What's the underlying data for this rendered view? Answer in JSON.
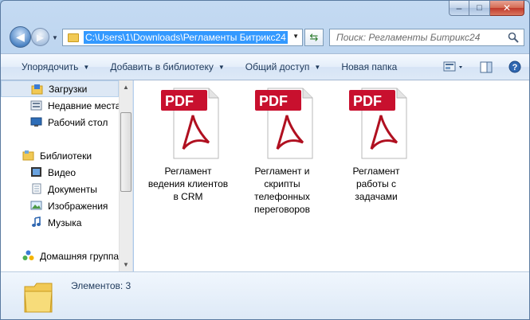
{
  "window": {
    "caption_buttons": {
      "minimize": "–",
      "maximize": "□",
      "close": "✕"
    }
  },
  "navigation": {
    "address_path": "C:\\Users\\1\\Downloads\\Регламенты Битрикс24",
    "search_placeholder": "Поиск: Регламенты Битрикс24"
  },
  "toolbar": {
    "organize": "Упорядочить",
    "add_to_library": "Добавить в библиотеку",
    "share": "Общий доступ",
    "new_folder": "Новая папка",
    "help": "?"
  },
  "sidebar": {
    "items": [
      {
        "label": "Загрузки",
        "icon": "downloads-folder-icon",
        "selected": true
      },
      {
        "label": "Недавние места",
        "icon": "recent-places-icon"
      },
      {
        "label": "Рабочий стол",
        "icon": "desktop-icon"
      },
      {
        "label": "Библиотеки",
        "icon": "libraries-icon"
      },
      {
        "label": "Видео",
        "icon": "video-icon"
      },
      {
        "label": "Документы",
        "icon": "documents-icon"
      },
      {
        "label": "Изображения",
        "icon": "images-icon"
      },
      {
        "label": "Музыка",
        "icon": "music-icon"
      },
      {
        "label": "Домашняя группа",
        "icon": "homegroup-icon"
      }
    ]
  },
  "files": [
    {
      "name": "Регламент ведения клиентов в CRM",
      "type_label": "PDF"
    },
    {
      "name": "Регламент и скрипты телефонных переговоров",
      "type_label": "PDF"
    },
    {
      "name": "Регламент работы с задачами",
      "type_label": "PDF"
    }
  ],
  "status": {
    "item_count": "Элементов: 3"
  },
  "colors": {
    "accent": "#3399ff",
    "pdf_red": "#c8102e"
  }
}
